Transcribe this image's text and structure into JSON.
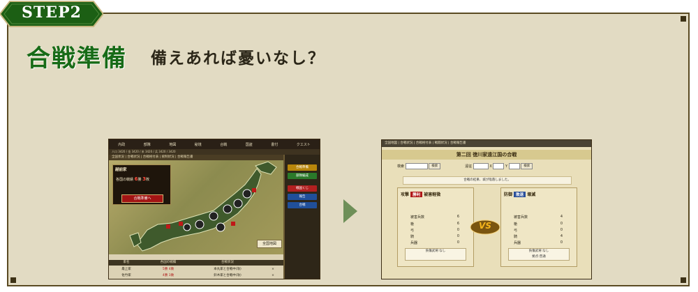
{
  "step": {
    "label": "STEP2"
  },
  "heading": {
    "title": "合戦準備",
    "subtitle": "備えあれば憂いなし？"
  },
  "colors": {
    "panel_bg": "#e2dbc3",
    "border": "#5a4a22",
    "title_green": "#176b17",
    "badge_green": "#1c5f14",
    "arrow_green": "#6e8f58"
  },
  "screenshot_left": {
    "nav": [
      "内政",
      "部隊",
      "地図",
      "秘境",
      "合戦",
      "国盗",
      "書付",
      "クエスト"
    ],
    "infobar": "人口 3420 / 金 3420 / 米 3420 / 兵 3420 / 3420",
    "breadcrumb": "全国状況 | 合戦状況 | 合戦格付表 | 統制状況 | 合戦報告書",
    "infobox": {
      "header": "越前家",
      "line": "各国の戦績",
      "score_win": "6",
      "score_loss": "3",
      "button": "合戦準備へ"
    },
    "side_buttons": [
      "合戦準備",
      "部隊編成",
      "戦国くじ",
      "報告",
      "合戦"
    ],
    "map_button": "全国地図",
    "table": {
      "headers": [
        "家名",
        "各国の戦績",
        "合戦状況"
      ],
      "rows": [
        {
          "house": "最上家",
          "record": "5勝 4敗",
          "status": "本丸家と合戦中(攻)",
          "mark": "×"
        },
        {
          "house": "佐竹家",
          "record": "4勝 3敗",
          "status": "鈴木家と合戦中(攻)",
          "mark": "×"
        }
      ]
    }
  },
  "screenshot_right": {
    "nav": "全国地図 | 合戦状況 | 合戦格付表 | 戦闘状況 | 合戦報告書",
    "title": "第二回 徳川家遠江国の合戦",
    "search": {
      "label1": "検索",
      "button": "検索",
      "label2": "遠征",
      "label3": "X",
      "label4": "Y",
      "button2": "検索"
    },
    "message": "合戦の結果、城が陥落しました。",
    "attack": {
      "title": "攻撃",
      "result": "勝利",
      "note": "被害軽微",
      "stats": [
        {
          "label": "被害兵数",
          "value": "6"
        },
        {
          "label": "槍",
          "value": "6"
        },
        {
          "label": "弓",
          "value": "0"
        },
        {
          "label": "騎",
          "value": "0"
        },
        {
          "label": "兵器",
          "value": "0"
        }
      ],
      "footer": "負傷武将:なし"
    },
    "defense": {
      "title": "防御",
      "result": "敗退",
      "note": "壊滅",
      "stats": [
        {
          "label": "被害兵数",
          "value": "4"
        },
        {
          "label": "槍",
          "value": "0"
        },
        {
          "label": "弓",
          "value": "0"
        },
        {
          "label": "騎",
          "value": "4"
        },
        {
          "label": "兵器",
          "value": "0"
        }
      ],
      "footer1": "負傷武将:なし",
      "footer2": "拠点:普通"
    },
    "vs": "VS"
  }
}
